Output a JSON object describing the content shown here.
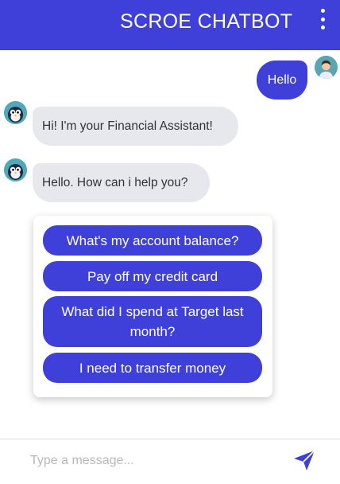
{
  "header": {
    "title": "SCROE CHATBOT",
    "menu_icon": "more-vertical-icon"
  },
  "messages": [
    {
      "from": "user",
      "text": "Hello"
    },
    {
      "from": "bot",
      "text": "Hi! I'm your Financial Assistant!"
    },
    {
      "from": "bot",
      "text": "Hello. How can i help you?"
    }
  ],
  "quick_replies": [
    "What's my account balance?",
    "Pay off my credit card",
    "What did I spend at Target last month?",
    "I need to transfer money"
  ],
  "composer": {
    "placeholder": "Type a message...",
    "send_icon": "send-icon"
  },
  "colors": {
    "accent": "#3f40d9",
    "bot_bubble": "#e6e8ee",
    "avatar_bg": "#4fa9b6"
  }
}
